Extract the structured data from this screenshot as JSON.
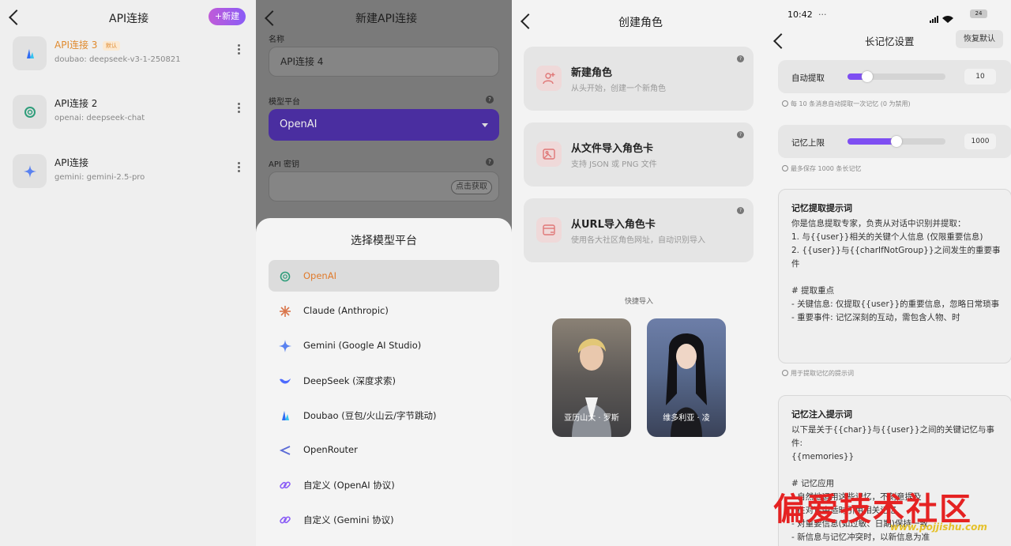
{
  "p1": {
    "title": "API连接",
    "new_label": "+新建",
    "connections": [
      {
        "name": "API连接 3",
        "badge": "默认",
        "sub": "doubao: deepseek-v3-1-250821",
        "icon": "doubao-icon"
      },
      {
        "name": "API连接 2",
        "sub": "openai: deepseek-chat",
        "icon": "openai-icon"
      },
      {
        "name": "API连接",
        "sub": "gemini: gemini-2.5-pro",
        "icon": "gemini-icon"
      }
    ]
  },
  "p2": {
    "title": "新建API连接",
    "name_label": "名称",
    "name_value": "API连接 4",
    "platform_label": "模型平台",
    "platform_value": "OpenAI",
    "key_label": "API 密钥",
    "get_key": "点击获取",
    "sheet_title": "选择模型平台",
    "options": [
      {
        "label": "OpenAI",
        "icon": "openai-icon"
      },
      {
        "label": "Claude (Anthropic)",
        "icon": "claude-icon"
      },
      {
        "label": "Gemini (Google AI Studio)",
        "icon": "gemini-icon"
      },
      {
        "label": "DeepSeek (深度求索)",
        "icon": "deepseek-icon"
      },
      {
        "label": "Doubao (豆包/火山云/字节跳动)",
        "icon": "doubao-icon"
      },
      {
        "label": "OpenRouter",
        "icon": "openrouter-icon"
      },
      {
        "label": "自定义 (OpenAI 协议)",
        "icon": "link-icon"
      },
      {
        "label": "自定义 (Gemini 协议)",
        "icon": "link-icon"
      }
    ]
  },
  "p3": {
    "title": "创建角色",
    "cards": [
      {
        "title": "新建角色",
        "sub": "从头开始，创建一个新角色",
        "icon": "user-plus-icon"
      },
      {
        "title": "从文件导入角色卡",
        "sub": "支持 JSON 或 PNG 文件",
        "icon": "image-import-icon"
      },
      {
        "title": "从URL导入角色卡",
        "sub": "使用各大社区角色网址，自动识别导入",
        "icon": "web-import-icon"
      }
    ],
    "quick_label": "快捷导入",
    "portraits": [
      {
        "name": "亚历山大 · 罗斯"
      },
      {
        "name": "维多利亚 · 凌"
      }
    ]
  },
  "p4": {
    "status_time": "10:42",
    "status_dots": "···",
    "battery": "24",
    "title": "长记忆设置",
    "reset": "恢复默认",
    "auto_label": "自动提取",
    "auto_value": "10",
    "auto_fraction": 0.2,
    "auto_hint": "每 10 条消息自动提取一次记忆 (0 为禁用)",
    "limit_label": "记忆上限",
    "limit_value": "1000",
    "limit_fraction": 0.5,
    "limit_hint": "最多保存 1000 条长记忆",
    "extract_title": "记忆提取提示词",
    "extract_body": "你是信息提取专家，负责从对话中识别并提取：\n1. 与{{user}}相关的关键个人信息 (仅限重要信息)\n2. {{user}}与{{charIfNotGroup}}之间发生的重要事件\n\n# 提取重点\n- 关键信息: 仅提取{{user}}的重要信息，忽略日常琐事\n- 重要事件: 记忆深刻的互动，需包含人物、时",
    "extract_hint": "用于提取记忆的提示词",
    "inject_title": "记忆注入提示词",
    "inject_body": "以下是关于{{char}}与{{user}}之间的关键记忆与事件:\n{{memories}}\n\n# 记忆应用\n- 自然地运用这些记忆，不刻意提及\n- 在对话中适时引用相关记忆\n- 对重要信息(如过敏、日期)保持一致\n- 新信息与记忆冲突时，以新信息为准"
  },
  "watermark": {
    "text": "偏爱技术社区",
    "url": "www.pojjishu.com"
  }
}
